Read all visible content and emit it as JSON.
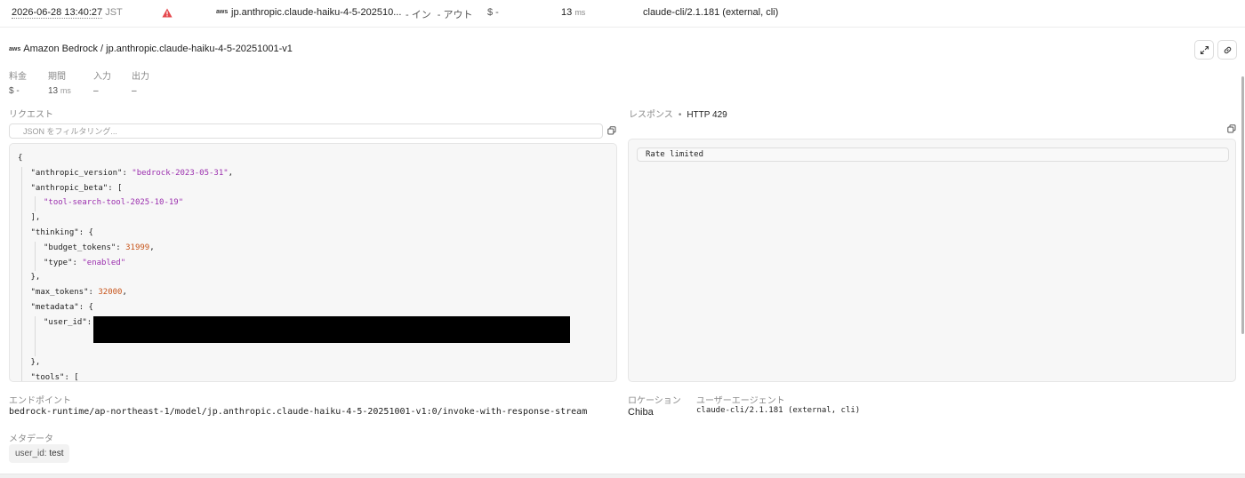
{
  "row": {
    "date": "2026-06-28 13:40:27",
    "tz": "JST",
    "provider_icon_text": "aws",
    "model": "jp.anthropic.claude-haiku-4-5-202510...",
    "in": "- イン",
    "out": "- アウト",
    "cost": "$ -",
    "duration": "13",
    "duration_unit": "ms",
    "user_agent": "claude-cli/2.1.181 (external, cli)"
  },
  "header": {
    "provider_icon_text": "aws",
    "title": "Amazon Bedrock / jp.anthropic.claude-haiku-4-5-20251001-v1"
  },
  "stats": {
    "cost_label": "料金",
    "cost_value": "$ -",
    "duration_label": "期間",
    "duration_value": "13",
    "duration_unit": "ms",
    "input_label": "入力",
    "input_value": "–",
    "output_label": "出力",
    "output_value": "–"
  },
  "request": {
    "label": "リクエスト",
    "filter_placeholder": "JSON をフィルタリング...",
    "lines": [
      {
        "indent": 0,
        "parts": [
          {
            "t": "p",
            "v": "{"
          }
        ]
      },
      {
        "indent": 1,
        "parts": [
          {
            "t": "k",
            "v": "\"anthropic_version\""
          },
          {
            "t": "p",
            "v": ": "
          },
          {
            "t": "s",
            "v": "\"bedrock-2023-05-31\""
          },
          {
            "t": "p",
            "v": ","
          }
        ]
      },
      {
        "indent": 1,
        "parts": [
          {
            "t": "k",
            "v": "\"anthropic_beta\""
          },
          {
            "t": "p",
            "v": ": ["
          }
        ]
      },
      {
        "indent": 2,
        "parts": [
          {
            "t": "s",
            "v": "\"tool-search-tool-2025-10-19\""
          }
        ]
      },
      {
        "indent": 1,
        "parts": [
          {
            "t": "p",
            "v": "],"
          }
        ]
      },
      {
        "indent": 1,
        "parts": [
          {
            "t": "k",
            "v": "\"thinking\""
          },
          {
            "t": "p",
            "v": ": {"
          }
        ]
      },
      {
        "indent": 2,
        "parts": [
          {
            "t": "k",
            "v": "\"budget_tokens\""
          },
          {
            "t": "p",
            "v": ": "
          },
          {
            "t": "n",
            "v": "31999"
          },
          {
            "t": "p",
            "v": ","
          }
        ]
      },
      {
        "indent": 2,
        "parts": [
          {
            "t": "k",
            "v": "\"type\""
          },
          {
            "t": "p",
            "v": ": "
          },
          {
            "t": "s",
            "v": "\"enabled\""
          }
        ]
      },
      {
        "indent": 1,
        "parts": [
          {
            "t": "p",
            "v": "},"
          }
        ]
      },
      {
        "indent": 1,
        "parts": [
          {
            "t": "k",
            "v": "\"max_tokens\""
          },
          {
            "t": "p",
            "v": ": "
          },
          {
            "t": "n",
            "v": "32000"
          },
          {
            "t": "p",
            "v": ","
          }
        ]
      },
      {
        "indent": 1,
        "parts": [
          {
            "t": "k",
            "v": "\"metadata\""
          },
          {
            "t": "p",
            "v": ": {"
          }
        ]
      },
      {
        "indent": 2,
        "parts": [
          {
            "t": "k",
            "v": "\"user_id\""
          },
          {
            "t": "p",
            "v": ":"
          }
        ]
      },
      {
        "indent": 0,
        "parts": [
          {
            "t": "p",
            "v": ""
          }
        ]
      },
      {
        "indent": 1,
        "parts": [
          {
            "t": "p",
            "v": "},"
          }
        ]
      },
      {
        "indent": 1,
        "parts": [
          {
            "t": "k",
            "v": "\"tools\""
          },
          {
            "t": "p",
            "v": ": ["
          }
        ]
      },
      {
        "indent": 2,
        "parts": [
          {
            "t": "p",
            "v": "{"
          }
        ]
      }
    ]
  },
  "response": {
    "label": "レスポンス",
    "status": "HTTP 429",
    "body": "Rate limited"
  },
  "endpoint": {
    "label": "エンドポイント",
    "value": "bedrock-runtime/ap-northeast-1/model/jp.anthropic.claude-haiku-4-5-20251001-v1:0/invoke-with-response-stream"
  },
  "location": {
    "label": "ロケーション",
    "value": "Chiba"
  },
  "user_agent": {
    "label": "ユーザーエージェント",
    "value": "claude-cli/2.1.181 (external, cli)"
  },
  "metadata": {
    "label": "メタデータ",
    "tag_key": "user_id:",
    "tag_value": "test"
  },
  "colors": {
    "warning": "#e5484d",
    "string": "#9b2fae",
    "number": "#c7541a"
  }
}
